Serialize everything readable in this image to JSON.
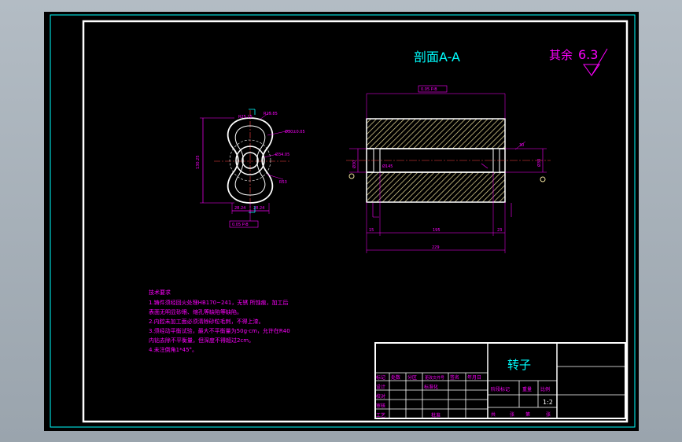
{
  "section": {
    "title": "剖面A-A"
  },
  "roughness": {
    "label": "其余",
    "value": "6.3"
  },
  "left_view": {
    "top_dim": "R19.85",
    "radius_dim": "R25.15",
    "bore_dim": "Ø30±0.05",
    "hole_dim": "Ø34.05",
    "notch_dim": "R53",
    "left_height": "130.25",
    "bottom_left": "28.24",
    "bottom_right": "28.24",
    "tolerance_box": "0.05 P-B"
  },
  "right_view": {
    "tolerance_box": "0.05 P-B",
    "dim_left_small": "Ø30",
    "dim_bore": "Ø145",
    "dim_right_small": "Ø30",
    "angle_right": "30",
    "dim_15": "15",
    "dim_195": "195",
    "dim_23": "23",
    "dim_229": "229"
  },
  "notes": {
    "heading": "技术要求",
    "lines": [
      "1.铸件须经回火处理HB170~241，无锈 所蚀痕，加工后",
      "表面无明显砂眼、缩孔等缺陷等缺陷。",
      "2.内腔未加工面必须清除砂粒毛刺，不得上漆。",
      "3.须经动平衡试验，最大不平衡量为50g·cm，允许在R40",
      "内钻去除不平衡量，但深度不得超过2cm。",
      "4.未注倒角1*45°。"
    ]
  },
  "title_block": {
    "part_name": "转子",
    "scale": "1:2",
    "headers": [
      "标记",
      "处数",
      "分区",
      "更改文件号",
      "签名",
      "年月日"
    ],
    "rows": [
      "设计",
      "校对",
      "审核",
      "工艺"
    ],
    "standardization": "标准化",
    "approve": "批准",
    "stage_mark": "阶段标记",
    "weight": "重量",
    "scale_label": "比例",
    "sheet_total": "共",
    "sheet_unit": "张",
    "sheet_no": "第",
    "sheet_unit2": "张"
  }
}
